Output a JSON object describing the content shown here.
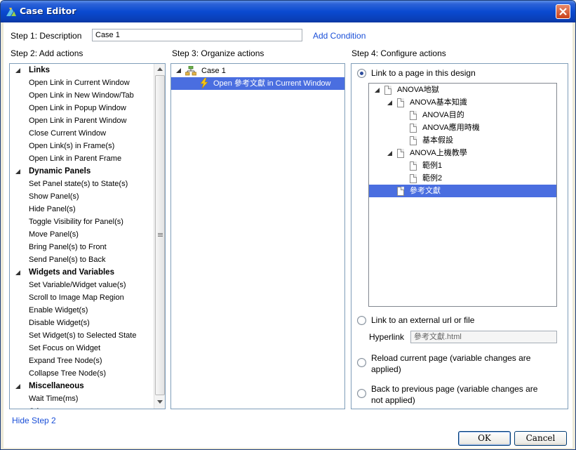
{
  "window": {
    "title": "Case Editor"
  },
  "step1": {
    "label": "Step 1: Description",
    "value": "Case 1",
    "add_condition": "Add Condition"
  },
  "step2": {
    "label": "Step 2: Add actions",
    "groups": [
      {
        "name": "Links",
        "items": [
          "Open Link in Current Window",
          "Open Link in New Window/Tab",
          "Open Link in Popup Window",
          "Open Link in Parent Window",
          "Close Current Window",
          "Open Link(s) in Frame(s)",
          "Open Link in Parent Frame"
        ]
      },
      {
        "name": "Dynamic Panels",
        "items": [
          "Set Panel state(s) to State(s)",
          "Show Panel(s)",
          "Hide Panel(s)",
          "Toggle Visibility for Panel(s)",
          "Move Panel(s)",
          "Bring Panel(s) to Front",
          "Send Panel(s) to Back"
        ]
      },
      {
        "name": "Widgets and Variables",
        "items": [
          "Set Variable/Widget value(s)",
          "Scroll to Image Map Region",
          "Enable Widget(s)",
          "Disable Widget(s)",
          "Set Widget(s) to Selected State",
          "Set Focus on Widget",
          "Expand Tree Node(s)",
          "Collapse Tree Node(s)"
        ]
      },
      {
        "name": "Miscellaneous",
        "items": [
          "Wait Time(ms)",
          "Other"
        ]
      }
    ]
  },
  "step3": {
    "label": "Step 3: Organize actions",
    "case_label": "Case 1",
    "action_label": "Open 參考文獻 in Current Window"
  },
  "step4": {
    "label": "Step 4: Configure actions",
    "option_page": "Link to a page in this design",
    "tree": {
      "root": "ANOVA地獄",
      "n1": "ANOVA基本知識",
      "n1a": "ANOVA目的",
      "n1b": "ANOVA應用時機",
      "n1c": "基本假設",
      "n2": "ANOVA上機教學",
      "n2a": "範例1",
      "n2b": "範例2",
      "n3": "參考文獻"
    },
    "option_url": "Link to an external url or file",
    "hyperlink_label": "Hyperlink",
    "hyperlink_value": "參考文獻.html",
    "option_reload_1": "Reload current page (variable changes are",
    "option_reload_2": "applied)",
    "option_back_1": "Back to previous page (variable changes are",
    "option_back_2": "not applied)"
  },
  "footer": {
    "hide_step2": "Hide Step 2",
    "ok": "OK",
    "cancel": "Cancel"
  }
}
